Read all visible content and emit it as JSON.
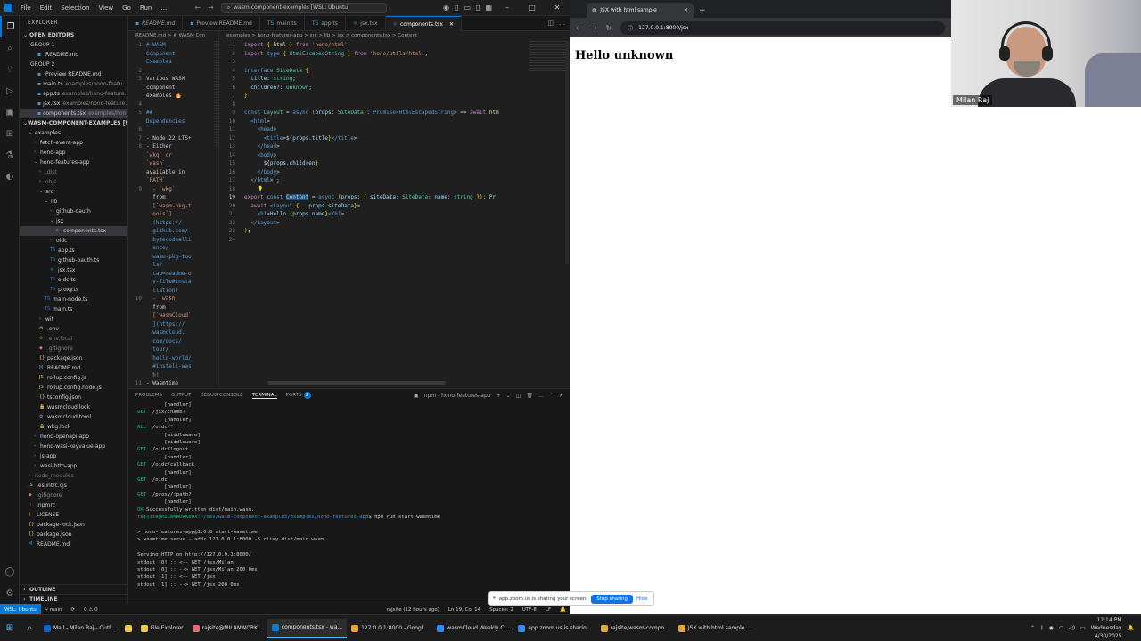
{
  "vscode": {
    "menu": [
      "File",
      "Edit",
      "Selection",
      "View",
      "Go",
      "Run"
    ],
    "command_center": "wasm-component-examples [WSL: Ubuntu]",
    "explorer": {
      "title": "EXPLORER",
      "open_editors_label": "OPEN EDITORS",
      "group1_label": "GROUP 1",
      "group1_items": [
        {
          "name": "README.md",
          "path": ""
        }
      ],
      "group2_label": "GROUP 2",
      "group2_items": [
        {
          "name": "Preview README.md",
          "path": ""
        },
        {
          "name": "main.ts",
          "path": "examples/hono-featu..."
        },
        {
          "name": "app.ts",
          "path": "examples/hono-feature..."
        },
        {
          "name": "jsx.tsx",
          "path": "examples/hono-feature..."
        },
        {
          "name": "components.tsx",
          "path": "examples/hono-..."
        }
      ],
      "root_label": "WASM-COMPONENT-EXAMPLES [WSL: UBU...",
      "tree": [
        {
          "name": "examples",
          "indent": 1,
          "kind": "folder-open"
        },
        {
          "name": "fetch-event-app",
          "indent": 2,
          "kind": "folder"
        },
        {
          "name": "hono-app",
          "indent": 2,
          "kind": "folder"
        },
        {
          "name": "hono-features-app",
          "indent": 2,
          "kind": "folder-open"
        },
        {
          "name": ".dist",
          "indent": 3,
          "kind": "folder-dim"
        },
        {
          "name": "objs",
          "indent": 3,
          "kind": "folder-dim"
        },
        {
          "name": "src",
          "indent": 3,
          "kind": "folder-open"
        },
        {
          "name": "lib",
          "indent": 4,
          "kind": "folder-open"
        },
        {
          "name": "github-oauth",
          "indent": 5,
          "kind": "folder"
        },
        {
          "name": "jsx",
          "indent": 5,
          "kind": "folder-open"
        },
        {
          "name": "components.tsx",
          "indent": 6,
          "kind": "file-tsx",
          "selected": true
        },
        {
          "name": "oidc",
          "indent": 5,
          "kind": "folder"
        },
        {
          "name": "app.ts",
          "indent": 5,
          "kind": "file-ts"
        },
        {
          "name": "github-oauth.ts",
          "indent": 5,
          "kind": "file-ts"
        },
        {
          "name": "jsx.tsx",
          "indent": 5,
          "kind": "file-tsx"
        },
        {
          "name": "oidc.ts",
          "indent": 5,
          "kind": "file-ts"
        },
        {
          "name": "proxy.ts",
          "indent": 5,
          "kind": "file-ts"
        },
        {
          "name": "main-node.ts",
          "indent": 4,
          "kind": "file-ts"
        },
        {
          "name": "main.ts",
          "indent": 4,
          "kind": "file-ts"
        },
        {
          "name": "wit",
          "indent": 3,
          "kind": "folder"
        },
        {
          "name": ".env",
          "indent": 3,
          "kind": "file-env"
        },
        {
          "name": ".env.local",
          "indent": 3,
          "kind": "file-env-dim"
        },
        {
          "name": ".gitignore",
          "indent": 3,
          "kind": "file-git"
        },
        {
          "name": "package.json",
          "indent": 3,
          "kind": "file-json"
        },
        {
          "name": "README.md",
          "indent": 3,
          "kind": "file-md"
        },
        {
          "name": "rollup.config.js",
          "indent": 3,
          "kind": "file-js"
        },
        {
          "name": "rollup.config.node.js",
          "indent": 3,
          "kind": "file-js"
        },
        {
          "name": "tsconfig.json",
          "indent": 3,
          "kind": "file-json"
        },
        {
          "name": "wasmcloud.lock",
          "indent": 3,
          "kind": "file-lock"
        },
        {
          "name": "wasmcloud.toml",
          "indent": 3,
          "kind": "file-toml"
        },
        {
          "name": "wkg.lock",
          "indent": 3,
          "kind": "file-lock"
        },
        {
          "name": "hono-openapi-app",
          "indent": 2,
          "kind": "folder"
        },
        {
          "name": "hono-wasi-keyvalue-app",
          "indent": 2,
          "kind": "folder"
        },
        {
          "name": "js-app",
          "indent": 2,
          "kind": "folder"
        },
        {
          "name": "wasi-http-app",
          "indent": 2,
          "kind": "folder"
        },
        {
          "name": "node_modules",
          "indent": 1,
          "kind": "folder-dim"
        },
        {
          "name": ".eslintrc.cjs",
          "indent": 1,
          "kind": "file-js"
        },
        {
          "name": ".gitignore",
          "indent": 1,
          "kind": "file-git"
        },
        {
          "name": ".npmrc",
          "indent": 1,
          "kind": "file-npm"
        },
        {
          "name": "LICENSE",
          "indent": 1,
          "kind": "file-lic"
        },
        {
          "name": "package-lock.json",
          "indent": 1,
          "kind": "file-json"
        },
        {
          "name": "package.json",
          "indent": 1,
          "kind": "file-json"
        },
        {
          "name": "README.md",
          "indent": 1,
          "kind": "file-md"
        }
      ],
      "outline_label": "OUTLINE",
      "timeline_label": "TIMELINE"
    },
    "tabs": [
      {
        "label": "README.md",
        "active": false
      },
      {
        "label": "Preview README.md",
        "active": false
      },
      {
        "label": "main.ts",
        "active": false
      },
      {
        "label": "app.ts",
        "active": false
      },
      {
        "label": "jsx.tsx",
        "active": false
      },
      {
        "label": "components.tsx",
        "active": true
      }
    ],
    "md_breadcrumb": "README.md > # WASM Con",
    "md_lines": [
      {
        "n": "1",
        "t": "# WASM",
        "c": "h"
      },
      {
        "n": "",
        "t": "Component",
        "c": "h"
      },
      {
        "n": "",
        "t": "Examples",
        "c": "h"
      },
      {
        "n": "2",
        "t": "",
        "c": "b"
      },
      {
        "n": "3",
        "t": "Various WASM",
        "c": "b"
      },
      {
        "n": "",
        "t": "component",
        "c": "b"
      },
      {
        "n": "",
        "t": "examples 🔥",
        "c": "b"
      },
      {
        "n": "4",
        "t": "",
        "c": "b"
      },
      {
        "n": "5",
        "t": "##",
        "c": "h"
      },
      {
        "n": "",
        "t": "Dependencies",
        "c": "h"
      },
      {
        "n": "6",
        "t": "",
        "c": "b"
      },
      {
        "n": "7",
        "t": "- Node 22 LTS+",
        "c": "b"
      },
      {
        "n": "8",
        "t": "- Either",
        "c": "b"
      },
      {
        "n": "",
        "t": "`wkg` or",
        "c": "l"
      },
      {
        "n": "",
        "t": "`wash`",
        "c": "l"
      },
      {
        "n": "",
        "t": "available in",
        "c": "b"
      },
      {
        "n": "",
        "t": "`PATH`",
        "c": "l"
      },
      {
        "n": "9",
        "t": "  - `wkg`",
        "c": "l"
      },
      {
        "n": "",
        "t": "  from",
        "c": "b"
      },
      {
        "n": "",
        "t": "  [`wasm-pkg-t",
        "c": "l"
      },
      {
        "n": "",
        "t": "  ools`]",
        "c": "l"
      },
      {
        "n": "",
        "t": "  (https://",
        "c": "h"
      },
      {
        "n": "",
        "t": "  github.com/",
        "c": "h"
      },
      {
        "n": "",
        "t": "  bytecodealli",
        "c": "h"
      },
      {
        "n": "",
        "t": "  ance/",
        "c": "h"
      },
      {
        "n": "",
        "t": "  wasm-pkg-too",
        "c": "h"
      },
      {
        "n": "",
        "t": "  ls?",
        "c": "h"
      },
      {
        "n": "",
        "t": "  tab=readme-o",
        "c": "h"
      },
      {
        "n": "",
        "t": "  v-file#insta",
        "c": "h"
      },
      {
        "n": "",
        "t": "  llation)",
        "c": "h"
      },
      {
        "n": "10",
        "t": "  - `wash`",
        "c": "l"
      },
      {
        "n": "",
        "t": "  from",
        "c": "b"
      },
      {
        "n": "",
        "t": "  [`wasmCloud`",
        "c": "l"
      },
      {
        "n": "",
        "t": "  ](https://",
        "c": "h"
      },
      {
        "n": "",
        "t": "  wasmcloud.",
        "c": "h"
      },
      {
        "n": "",
        "t": "  com/docs/",
        "c": "h"
      },
      {
        "n": "",
        "t": "  tour/",
        "c": "h"
      },
      {
        "n": "",
        "t": "  hello-world/",
        "c": "h"
      },
      {
        "n": "",
        "t": "  #install-was",
        "c": "h"
      },
      {
        "n": "",
        "t": "  h)",
        "c": "h"
      },
      {
        "n": "11",
        "t": "- Wasmtime",
        "c": "b"
      }
    ],
    "code_breadcrumb": "examples > hono-features-app > src > lib > jsx > components.tsx > Content",
    "code_lines": [
      {
        "n": "1",
        "t": "import { html } from 'hono/html';"
      },
      {
        "n": "2",
        "t": "import type { HtmlEscapedString } from 'hono/utils/html';"
      },
      {
        "n": "3",
        "t": ""
      },
      {
        "n": "4",
        "t": "interface SiteData {"
      },
      {
        "n": "5",
        "t": "  title: string;"
      },
      {
        "n": "6",
        "t": "  children?: unknown;"
      },
      {
        "n": "7",
        "t": "}"
      },
      {
        "n": "8",
        "t": ""
      },
      {
        "n": "9",
        "t": "const Layout = async (props: SiteData): Promise<HtmlEscapedString> => await htm"
      },
      {
        "n": "10",
        "t": "  <html>"
      },
      {
        "n": "11",
        "t": "    <head>"
      },
      {
        "n": "12",
        "t": "      <title>${props.title}</title>"
      },
      {
        "n": "13",
        "t": "    </head>"
      },
      {
        "n": "14",
        "t": "    <body>"
      },
      {
        "n": "15",
        "t": "      ${props.children}"
      },
      {
        "n": "16",
        "t": "    </body>"
      },
      {
        "n": "17",
        "t": "  </html>`;"
      },
      {
        "n": "18",
        "t": ""
      },
      {
        "n": "19",
        "t": "export const Content = async (props: { siteData: SiteData; name: string }): Pr"
      },
      {
        "n": "20",
        "t": "  await <Layout {...props.siteData}>"
      },
      {
        "n": "21",
        "t": "    <h1>Hello {props.name}</h1>"
      },
      {
        "n": "22",
        "t": "  </Layout>"
      },
      {
        "n": "23",
        "t": ");"
      },
      {
        "n": "24",
        "t": ""
      }
    ],
    "panel_tabs": [
      "PROBLEMS",
      "OUTPUT",
      "DEBUG CONSOLE",
      "TERMINAL",
      "PORTS"
    ],
    "ports_count": "2",
    "terminal_title": "npm - hono-features-app",
    "terminal_lines": [
      "         [handler]",
      "GET  /jsx/:name?",
      "         [handler]",
      "ALL  /oidc/*",
      "         [middleware]",
      "         [middleware]",
      "GET  /oidc/logout",
      "         [handler]",
      "GET  /oidc/callback",
      "         [handler]",
      "GET  /oidc",
      "         [handler]",
      "GET  /proxy/:path?",
      "         [handler]",
      "OK Successfully written dist/main.wasm.",
      "rajsite@MILANWORKBOX:~/dev/wasm-component-examples/examples/hono-features-app$ npm run start-wasmtime",
      "",
      "> hono-features-app@1.0.0 start-wasmtime",
      "> wasmtime serve --addr 127.0.0.1:8000 -S cli=y dist/main.wasm",
      "",
      "Serving HTTP on http://127.0.0.1:8000/",
      "stdout [0] :: <-- GET /jsx/Milan",
      "stdout [0] :: --> GET /jsx/Milan 200 0ms",
      "stdout [1] :: <-- GET /jsx",
      "stdout [1] :: --> GET /jsx 200 0ms"
    ],
    "status": {
      "remote": "WSL: Ubuntu",
      "branch": "main",
      "sync": "0 ⚠ 0",
      "git_author": "rajsite (12 hours ago)",
      "position": "Ln 19, Col 14",
      "spaces": "Spaces: 2",
      "encoding": "UTF-8",
      "eol": "LF"
    }
  },
  "browser": {
    "tab_title": "JSX with html sample",
    "url": "127.0.0.1:8000/jsx",
    "heading": "Hello unknown"
  },
  "webcam": {
    "name": "Milan Raj"
  },
  "share_bar": {
    "text": "app.zoom.us is sharing your screen.",
    "stop_label": "Stop sharing",
    "hide_label": "Hide"
  },
  "taskbar": {
    "apps": [
      {
        "label": "Mail - Milan Raj - Outl...",
        "color": "#0a64c8",
        "active": false
      },
      {
        "label": "",
        "color": "#f2c94c",
        "active": false
      },
      {
        "label": "File Explorer",
        "color": "#f2c94c",
        "active": false
      },
      {
        "label": "rajsite@MILANWORK...",
        "color": "#e06c75",
        "active": false
      },
      {
        "label": "components.tsx - wa...",
        "color": "#0a7bd4",
        "active": true
      },
      {
        "label": "127.0.0.1:8000 - Googl...",
        "color": "#e0a43a",
        "active": false
      },
      {
        "label": "wasmCloud Weekly C...",
        "color": "#2d8cff",
        "active": false
      },
      {
        "label": "app.zoom.us is sharin...",
        "color": "#2d8cff",
        "active": false
      },
      {
        "label": "rajsite/wasm-compo...",
        "color": "#e0a43a",
        "active": false
      },
      {
        "label": "JSX with html sample ...",
        "color": "#e0a43a",
        "active": false
      }
    ],
    "time": "12:14 PM",
    "day": "Wednesday",
    "date": "4/30/2025"
  }
}
